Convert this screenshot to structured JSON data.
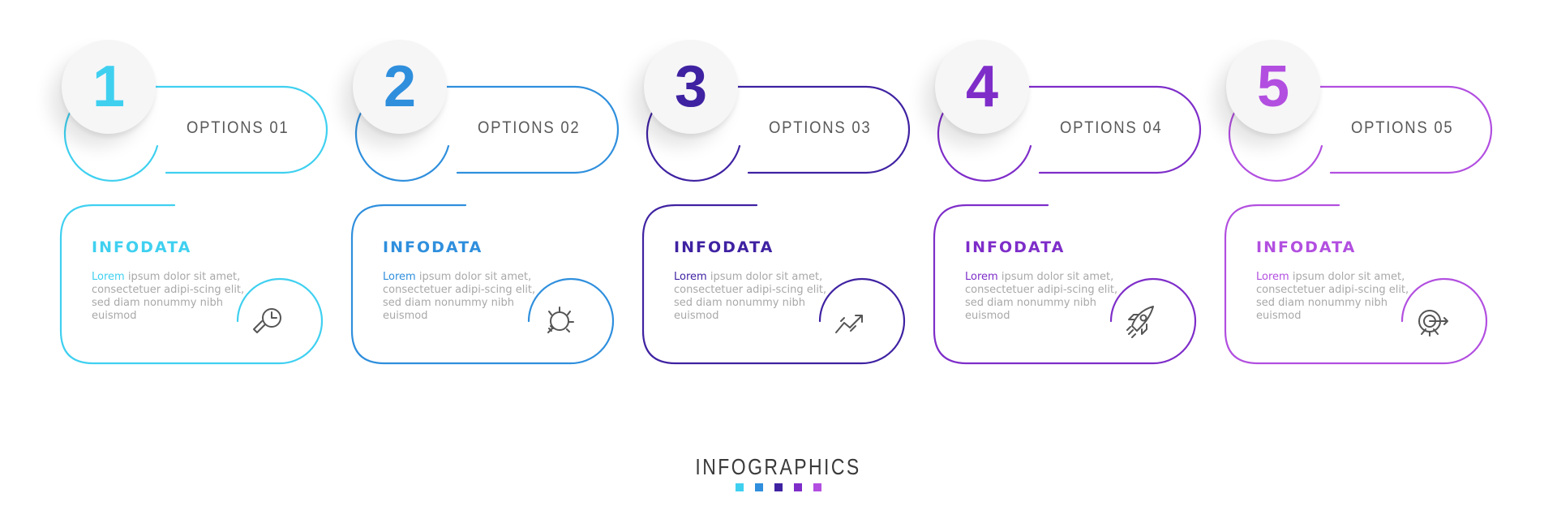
{
  "steps": [
    {
      "number": "1",
      "title": "OPTIONS 01",
      "info_title": "INFODATA",
      "lead": "Lorem",
      "text": " ipsum dolor sit amet, consectetuer adipi-scing elit, sed diam nonummy nibh euismod",
      "icon": "magnifier-clock-icon",
      "color": "#3fd0f0"
    },
    {
      "number": "2",
      "title": "OPTIONS 02",
      "info_title": "INFODATA",
      "lead": "Lorem",
      "text": " ipsum dolor sit amet, consectetuer adipi-scing elit, sed diam nonummy nibh euismod",
      "icon": "lightbulb-icon",
      "color": "#2f8fdd"
    },
    {
      "number": "3",
      "title": "OPTIONS 03",
      "info_title": "INFODATA",
      "lead": "Lorem",
      "text": " ipsum dolor sit amet, consectetuer adipi-scing elit, sed diam nonummy nibh euismod",
      "icon": "growth-chart-icon",
      "color": "#3f22a2"
    },
    {
      "number": "4",
      "title": "OPTIONS 04",
      "info_title": "INFODATA",
      "lead": "Lorem",
      "text": " ipsum dolor sit amet, consectetuer adipi-scing elit, sed diam nonummy nibh euismod",
      "icon": "rocket-icon",
      "color": "#7e2dc9"
    },
    {
      "number": "5",
      "title": "OPTIONS 05",
      "info_title": "INFODATA",
      "lead": "Lorem",
      "text": " ipsum dolor sit amet, consectetuer adipi-scing elit, sed diam nonummy nibh euismod",
      "icon": "target-icon",
      "color": "#b24fe0"
    }
  ],
  "footer": {
    "title": "INFOGRAPHICS",
    "swatches": [
      "#3fd0f0",
      "#2f8fdd",
      "#3f22a2",
      "#7e2dc9",
      "#b24fe0"
    ]
  }
}
